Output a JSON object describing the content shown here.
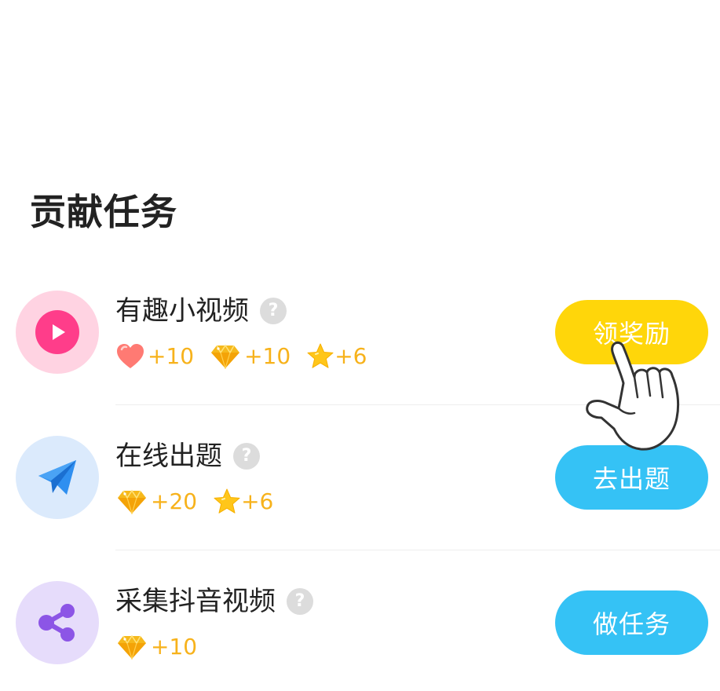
{
  "section_title": "贡献任务",
  "tasks": [
    {
      "name": "有趣小视频",
      "help": "?",
      "icon": "play-icon",
      "icon_bg": "#ffd3e2",
      "icon_fg": "#ff3d8a",
      "rewards": [
        {
          "icon": "heart-icon",
          "value": "+10"
        },
        {
          "icon": "diamond-icon",
          "value": "+10"
        },
        {
          "icon": "star-icon",
          "value": "+6"
        }
      ],
      "button": "领奖励",
      "button_color": "#ffd60a"
    },
    {
      "name": "在线出题",
      "help": "?",
      "icon": "paper-plane-icon",
      "icon_bg": "#dbeafc",
      "icon_fg": "#2f8ff0",
      "rewards": [
        {
          "icon": "diamond-icon",
          "value": "+20"
        },
        {
          "icon": "star-icon",
          "value": "+6"
        }
      ],
      "button": "去出题",
      "button_color": "#35c2f5"
    },
    {
      "name": "采集抖音视频",
      "help": "?",
      "icon": "share-icon",
      "icon_bg": "#e6dcfb",
      "icon_fg": "#8c55e6",
      "rewards": [
        {
          "icon": "diamond-icon",
          "value": "+10"
        }
      ],
      "button": "做任务",
      "button_color": "#35c2f5"
    }
  ],
  "overlay": {
    "icon": "pointing-hand-icon"
  }
}
